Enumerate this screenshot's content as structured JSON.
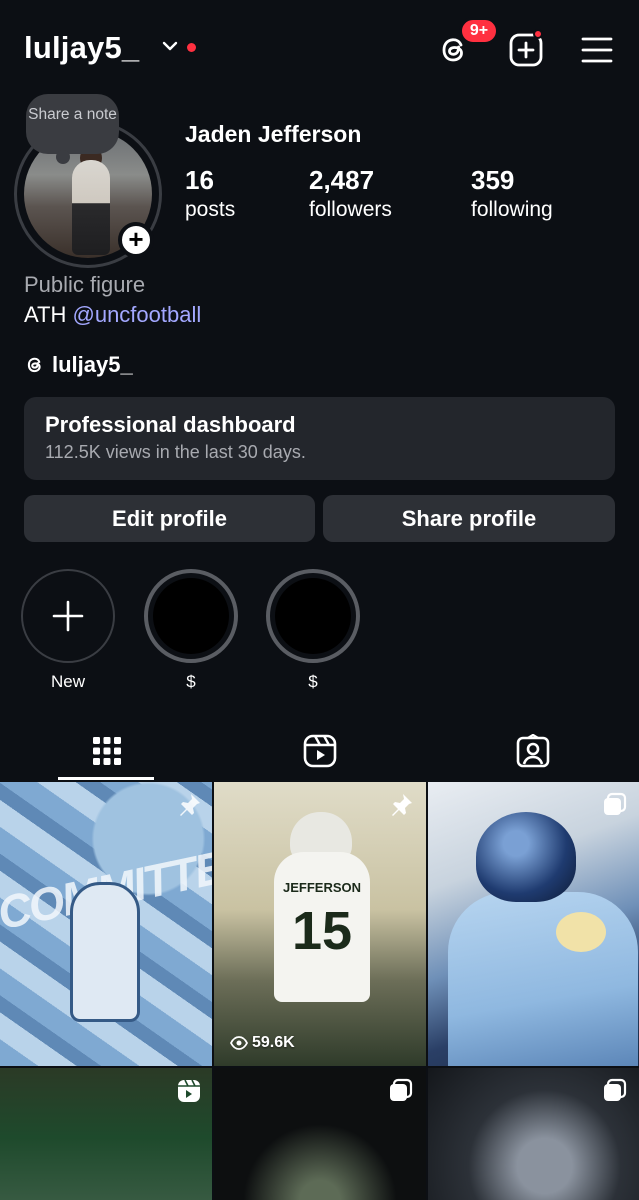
{
  "header": {
    "username": "luljay5_",
    "threads_badge": "9+"
  },
  "note": {
    "text": "Share a note"
  },
  "profile": {
    "full_name": "Jaden Jefferson",
    "stats": [
      {
        "value": "16",
        "label": "posts"
      },
      {
        "value": "2,487",
        "label": "followers"
      },
      {
        "value": "359",
        "label": "following"
      }
    ],
    "category": "Public figure",
    "bio_prefix": "ATH",
    "bio_mention": "@uncfootball",
    "threads_handle": "luljay5_"
  },
  "dashboard": {
    "title": "Professional dashboard",
    "subtitle": "112.5K views in the last 30 days."
  },
  "buttons": {
    "edit": "Edit profile",
    "share": "Share profile"
  },
  "highlights": [
    {
      "label": "New"
    },
    {
      "label": "$"
    },
    {
      "label": "$"
    }
  ],
  "tabs": [
    "grid-icon",
    "reels-icon",
    "tagged-icon"
  ],
  "posts": [
    {
      "text": "COMMITTED",
      "type": "post",
      "icon": "pin-icon"
    },
    {
      "jersey_name": "JEFFERSON",
      "jersey_number": "15",
      "views": "59.6K",
      "icon": "pin-icon"
    },
    {
      "type": "carousel",
      "icon": "carousel-icon"
    },
    {
      "type": "reel",
      "icon": "reel-icon"
    },
    {
      "type": "carousel",
      "icon": "carousel-icon"
    },
    {
      "type": "carousel",
      "icon": "carousel-icon"
    }
  ],
  "colors": {
    "background": "#0c0f14",
    "accent_red": "#ff3040",
    "mention": "#a3a8ff",
    "card": "#23262c",
    "button": "#2d3036"
  }
}
